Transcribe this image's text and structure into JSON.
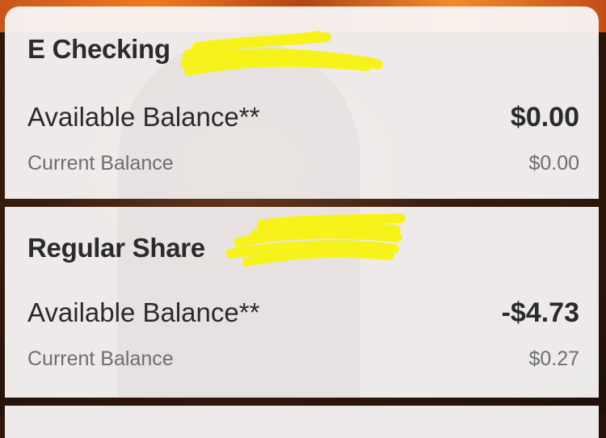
{
  "accounts": [
    {
      "name": "E Checking",
      "available_label": "Available Balance**",
      "available_value": "$0.00",
      "current_label": "Current Balance",
      "current_value": "$0.00"
    },
    {
      "name": "Regular Share",
      "available_label": "Available Balance**",
      "available_value": "-$4.73",
      "current_label": "Current Balance",
      "current_value": "$0.27"
    }
  ],
  "colors": {
    "redaction_highlight": "#f7f31a",
    "card_background": "#f8f6f6",
    "primary_text": "#2b2b2b",
    "secondary_text": "#6e6e70"
  }
}
